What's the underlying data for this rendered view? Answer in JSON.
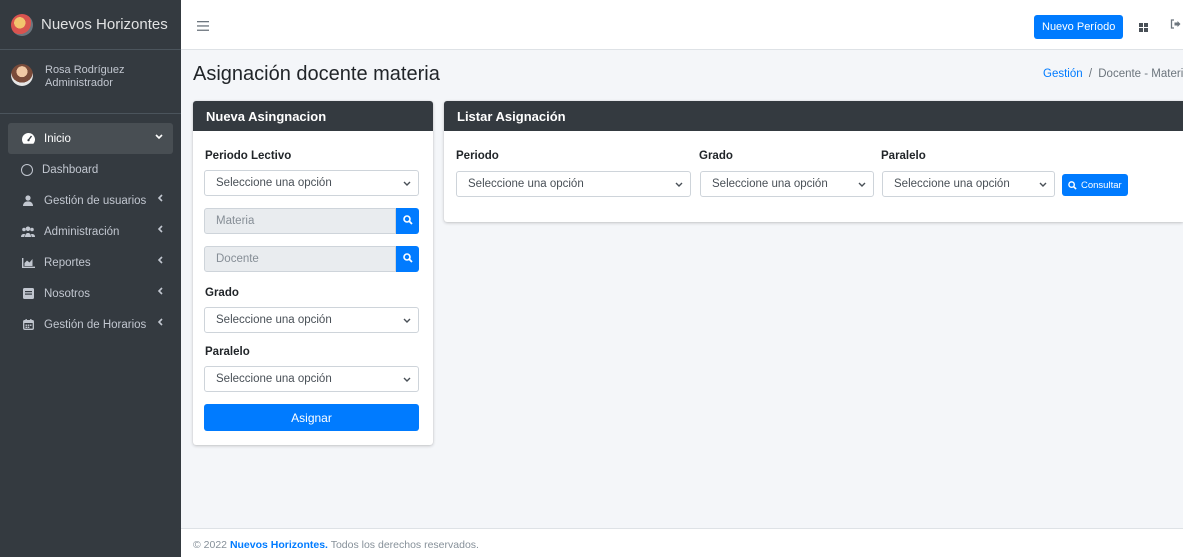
{
  "brand": {
    "name": "Nuevos Horizontes"
  },
  "user": {
    "name": "Rosa Rodríguez",
    "role": "Administrador"
  },
  "sidebar": {
    "items": [
      {
        "label": "Inicio",
        "icon": "tachometer-icon",
        "active": true
      },
      {
        "label": "Dashboard",
        "icon": "circle-icon"
      },
      {
        "label": "Gestión de usuarios",
        "icon": "user-icon"
      },
      {
        "label": "Administración",
        "icon": "users-icon"
      },
      {
        "label": "Reportes",
        "icon": "chart-area-icon"
      },
      {
        "label": "Nosotros",
        "icon": "book-icon"
      },
      {
        "label": "Gestión de Horarios",
        "icon": "calendar-icon"
      }
    ]
  },
  "topbar": {
    "new_period_label": "Nuevo Período"
  },
  "page": {
    "title": "Asignación docente materia",
    "breadcrumb_home": "Gestión",
    "breadcrumb_sep": "/",
    "breadcrumb_current": "Docente - Materia"
  },
  "new_assignment": {
    "title": "Nueva Asingnacion",
    "periodo_label": "Periodo Lectivo",
    "periodo_value": "Seleccione una opción",
    "materia_placeholder": "Materia",
    "docente_placeholder": "Docente",
    "grado_label": "Grado",
    "grado_value": "Seleccione una opción",
    "paralelo_label": "Paralelo",
    "paralelo_value": "Seleccione una opción",
    "assign_label": "Asignar"
  },
  "list_assignment": {
    "title": "Listar Asignación",
    "periodo_label": "Periodo",
    "periodo_value": "Seleccione una opción",
    "grado_label": "Grado",
    "grado_value": "Seleccione una opción",
    "paralelo_label": "Paralelo",
    "paralelo_value": "Seleccione una opción",
    "consult_label": "Consultar"
  },
  "footer": {
    "prefix": "© 2022",
    "brand": "Nuevos Horizontes.",
    "suffix": "Todos los derechos reservados."
  },
  "colors": {
    "primary": "#007bff",
    "sidebar_bg": "#343a40",
    "content_bg": "#f4f6f9"
  }
}
